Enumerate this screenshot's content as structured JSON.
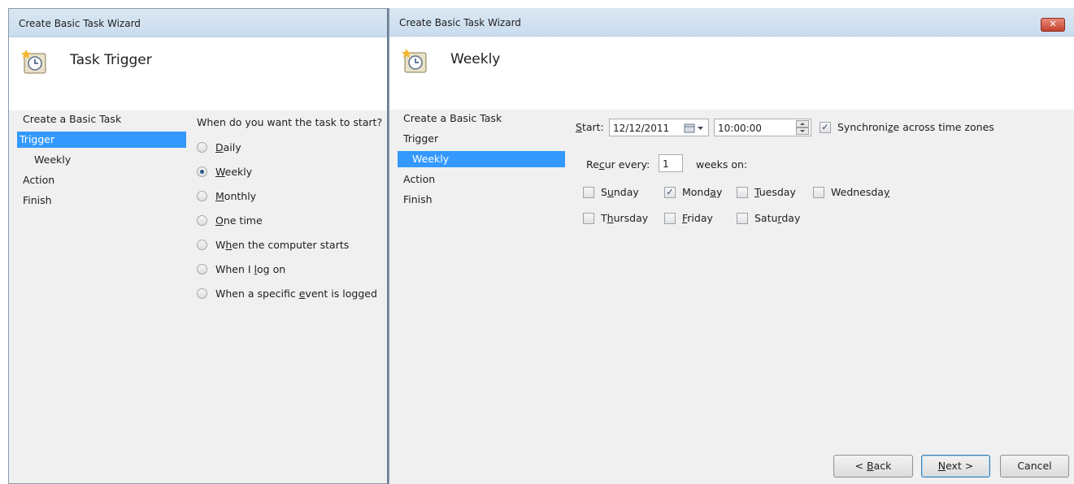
{
  "left_window": {
    "title": "Create Basic Task Wizard",
    "header_title": "Task Trigger",
    "nav": [
      "Create a Basic Task",
      "Trigger",
      "Weekly",
      "Action",
      "Finish"
    ],
    "question": "When do you want the task to start?",
    "options": [
      {
        "pre": "",
        "key": "D",
        "post": "aily",
        "checked": false
      },
      {
        "pre": "",
        "key": "W",
        "post": "eekly",
        "checked": true
      },
      {
        "pre": "",
        "key": "M",
        "post": "onthly",
        "checked": false
      },
      {
        "pre": "",
        "key": "O",
        "post": "ne time",
        "checked": false
      },
      {
        "pre": "W",
        "key": "h",
        "post": "en the computer starts",
        "checked": false
      },
      {
        "pre": "When I ",
        "key": "l",
        "post": "og on",
        "checked": false
      },
      {
        "pre": "When a specific ",
        "key": "e",
        "post": "vent is logged",
        "checked": false
      }
    ]
  },
  "right_window": {
    "title": "Create Basic Task Wizard",
    "close_label": "✕",
    "header_title": "Weekly",
    "nav": [
      "Create a Basic Task",
      "Trigger",
      "Weekly",
      "Action",
      "Finish"
    ],
    "start_label_key": "S",
    "start_label_rest": "tart:",
    "start_date": "12/12/2011",
    "start_time": "10:00:00",
    "sync_pre": "Synchroni",
    "sync_key": "z",
    "sync_post": "e across time zones",
    "sync_checked": true,
    "recur_pre": "Re",
    "recur_key": "c",
    "recur_post": "ur every:",
    "recur_value": "1",
    "weeks_on": "weeks on:",
    "days": [
      {
        "pre": "S",
        "key": "u",
        "post": "nday",
        "checked": false
      },
      {
        "pre": "Mond",
        "key": "a",
        "post": "y",
        "checked": true
      },
      {
        "pre": "",
        "key": "T",
        "post": "uesday",
        "checked": false
      },
      {
        "pre": "Wednesda",
        "key": "y",
        "post": "",
        "checked": false
      },
      {
        "pre": "T",
        "key": "h",
        "post": "ursday",
        "checked": false
      },
      {
        "pre": "",
        "key": "F",
        "post": "riday",
        "checked": false
      },
      {
        "pre": "Satu",
        "key": "r",
        "post": "day",
        "checked": false
      }
    ],
    "back_pre": "< ",
    "back_key": "B",
    "back_post": "ack",
    "next_key": "N",
    "next_post": "ext >",
    "cancel_label": "Cancel"
  },
  "colors": {
    "selection": "#3399ff",
    "titlebar": "#c9dcee",
    "panel": "#f0f0f0"
  },
  "icons": {
    "header": "task-scheduler-clock-icon",
    "calendar": "calendar-dropdown-icon",
    "spinner": "time-spinner-icon"
  }
}
